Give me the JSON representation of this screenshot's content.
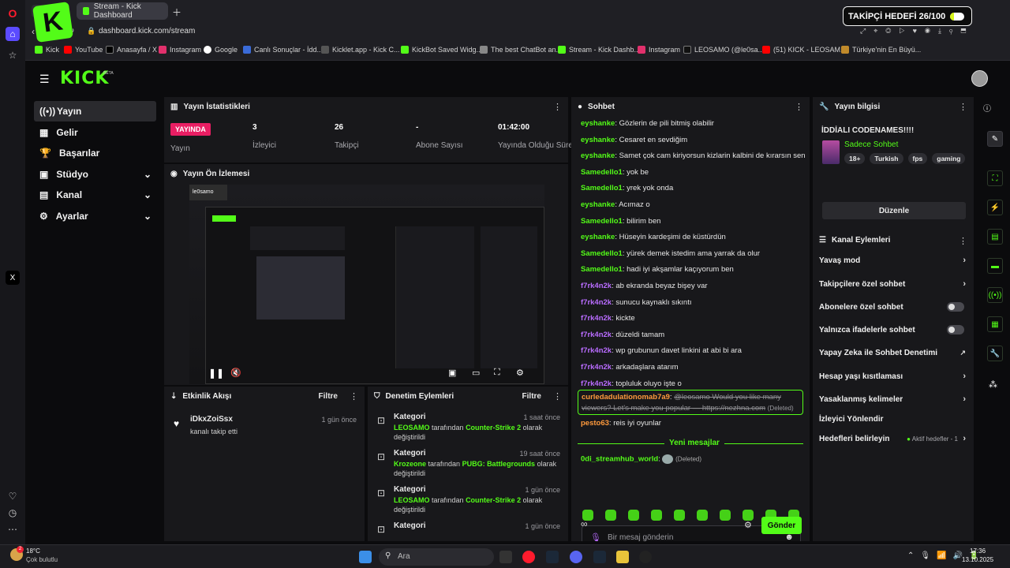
{
  "browser": {
    "tabs": [
      {
        "label": "Stream - Kick Dashboard"
      }
    ],
    "address": "dashboard.kick.com/stream",
    "bookmarks": [
      "Kick",
      "YouTube",
      "Anasayfa / X",
      "Instagram",
      "Google",
      "Canlı Sonuçlar - İdd...",
      "Kicklet.app - Kick C...",
      "KickBot Saved Widg...",
      "The best ChatBot an...",
      "Stream - Kick Dashb...",
      "Instagram",
      "LEOSAMO (@le0sa...",
      "(51) KICK - LEOSAM...",
      "Türkiye'nin En Büyü..."
    ]
  },
  "overlay": {
    "goal_label": "TAKİPÇİ HEDEFİ 26/100",
    "goal_fraction": 0.26,
    "webcam_name": "le0samo"
  },
  "nav": {
    "logo": "KICK",
    "logo_badge": "BETA",
    "items": [
      {
        "label": "Yayın",
        "icon": "broadcast-icon"
      },
      {
        "label": "Gelir",
        "icon": "money-icon"
      },
      {
        "label": "Başarılar",
        "icon": "trophy-icon"
      },
      {
        "label": "Stüdyo",
        "icon": "studio-icon"
      },
      {
        "label": "Kanal",
        "icon": "channel-icon"
      },
      {
        "label": "Ayarlar",
        "icon": "gear-icon"
      }
    ]
  },
  "stats": {
    "title": "Yayın İstatistikleri",
    "live_badge": "YAYINDA",
    "live_label": "Yayın",
    "items": [
      {
        "value": "3",
        "label": "İzleyici"
      },
      {
        "value": "26",
        "label": "Takipçi"
      },
      {
        "value": "-",
        "label": "Abone Sayısı"
      },
      {
        "value": "01:42:00",
        "label": "Yayında Olduğu Süre"
      }
    ]
  },
  "preview": {
    "title": "Yayın Ön İzlemesi"
  },
  "activity": {
    "title": "Etkinlik Akışı",
    "filter": "Filtre",
    "items": [
      {
        "user": "iDkxZoiSsx",
        "action": "kanalı takip etti",
        "time": "1 gün önce"
      }
    ]
  },
  "moderation": {
    "title": "Denetim Eylemleri",
    "filter": "Filtre",
    "items": [
      {
        "type": "Kategori",
        "time": "1 saat önce",
        "actor": "LEOSAMO",
        "mid": " tarafından ",
        "cat": "Counter-Strike 2",
        "post": " olarak",
        "line2": "değiştirildi"
      },
      {
        "type": "Kategori",
        "time": "19 saat önce",
        "actor": "Krozeone",
        "mid": " tarafından ",
        "cat": "PUBG: Battlegrounds",
        "post": " olarak",
        "line2": "değiştirildi"
      },
      {
        "type": "Kategori",
        "time": "1 gün önce",
        "actor": "LEOSAMO",
        "mid": " tarafından ",
        "cat": "Counter-Strike 2",
        "post": " olarak",
        "line2": "değiştirildi"
      },
      {
        "type": "Kategori",
        "time": "1 gün önce",
        "actor": "",
        "mid": "",
        "cat": "",
        "post": "",
        "line2": ""
      }
    ]
  },
  "chat": {
    "title": "Sohbet",
    "messages": [
      {
        "user": "eyshanke",
        "color": "green",
        "text": "Gözlerin de pili bitmiş olabilir"
      },
      {
        "user": "eyshanke",
        "color": "green",
        "text": "Cesaret en sevdiğim"
      },
      {
        "user": "eyshanke",
        "color": "green",
        "text": "Samet çok cam kiriyorsun kizlarin kalbini de kırarsın sen"
      },
      {
        "user": "Samedello1",
        "color": "green",
        "text": "yok be"
      },
      {
        "user": "Samedello1",
        "color": "green",
        "text": "yrek yok onda"
      },
      {
        "user": "eyshanke",
        "color": "green",
        "text": "Acımaz o"
      },
      {
        "user": "Samedello1",
        "color": "green",
        "text": "bilirim ben"
      },
      {
        "user": "eyshanke",
        "color": "green",
        "text": "Hüseyin kardeşimi de küstürdün"
      },
      {
        "user": "Samedello1",
        "color": "green",
        "text": "yürek demek istedim ama yarrak da olur"
      },
      {
        "user": "Samedello1",
        "color": "green",
        "text": "hadi iyi akşamlar kaçıyorum ben"
      },
      {
        "user": "f7rk4n2k",
        "color": "purple",
        "text": "ab ekranda beyaz bişey var"
      },
      {
        "user": "f7rk4n2k",
        "color": "purple",
        "text": "sunucu kaynaklı sıkıntı"
      },
      {
        "user": "f7rk4n2k",
        "color": "purple",
        "text": "kickte"
      },
      {
        "user": "f7rk4n2k",
        "color": "purple",
        "text": "düzeldi tamam"
      },
      {
        "user": "f7rk4n2k",
        "color": "purple",
        "text": "wp grubunun davet linkini at abi bi ara"
      },
      {
        "user": "f7rk4n2k",
        "color": "purple",
        "text": "arkadaşlara atarım"
      },
      {
        "user": "f7rk4n2k",
        "color": "purple",
        "text": "topluluk oluyo işte o"
      }
    ],
    "deleted": {
      "user": "curledadulationomab7a9",
      "text1": "@leosamo Would you like many",
      "text2": "viewers? Let's make you popular — https://nezhna.com",
      "tag": "(Deleted)"
    },
    "after": {
      "user": "pesto63",
      "text": "reis iyi oyunlar"
    },
    "new_divider": "Yeni mesajlar",
    "last": {
      "user": "0di_streamhub_world",
      "tag": "(Deleted)"
    },
    "input_placeholder": "Bir mesaj gönderin",
    "send": "Gönder"
  },
  "stream_info": {
    "title": "Yayın bilgisi",
    "stream_title": "İDDİALI CODENAMES!!!!",
    "category": "Sadece Sohbet",
    "tags": [
      "18+",
      "Turkish",
      "fps",
      "gaming"
    ],
    "edit": "Düzenle"
  },
  "channel_actions": {
    "title": "Kanal Eylemleri",
    "items": [
      {
        "label": "Yavaş mod",
        "control": "chevron"
      },
      {
        "label": "Takipçilere özel sohbet",
        "control": "chevron"
      },
      {
        "label": "Abonelere özel sohbet",
        "control": "toggle"
      },
      {
        "label": "Yalnızca ifadelerle sohbet",
        "control": "toggle"
      },
      {
        "label": "Yapay Zeka ile Sohbet Denetimi",
        "control": "external"
      },
      {
        "label": "Hesap yaşı kısıtlaması",
        "control": "chevron"
      },
      {
        "label": "Yasaklanmış kelimeler",
        "control": "chevron"
      },
      {
        "label": "İzleyici Yönlendir",
        "control": "none"
      },
      {
        "label": "Hedefleri belirleyin",
        "control": "chevron"
      }
    ],
    "goals_status": "Aktif hedefler - 1"
  },
  "taskbar": {
    "weather_temp": "18°C",
    "weather_desc": "Çok bulutlu",
    "search": "Ara",
    "time": "17:36",
    "date": "13.10.2025",
    "weather_badge": "2"
  },
  "colors": {
    "accent": "#53fc18",
    "live": "#e91e63",
    "panel": "#18181b",
    "bg": "#0b0b0d"
  }
}
